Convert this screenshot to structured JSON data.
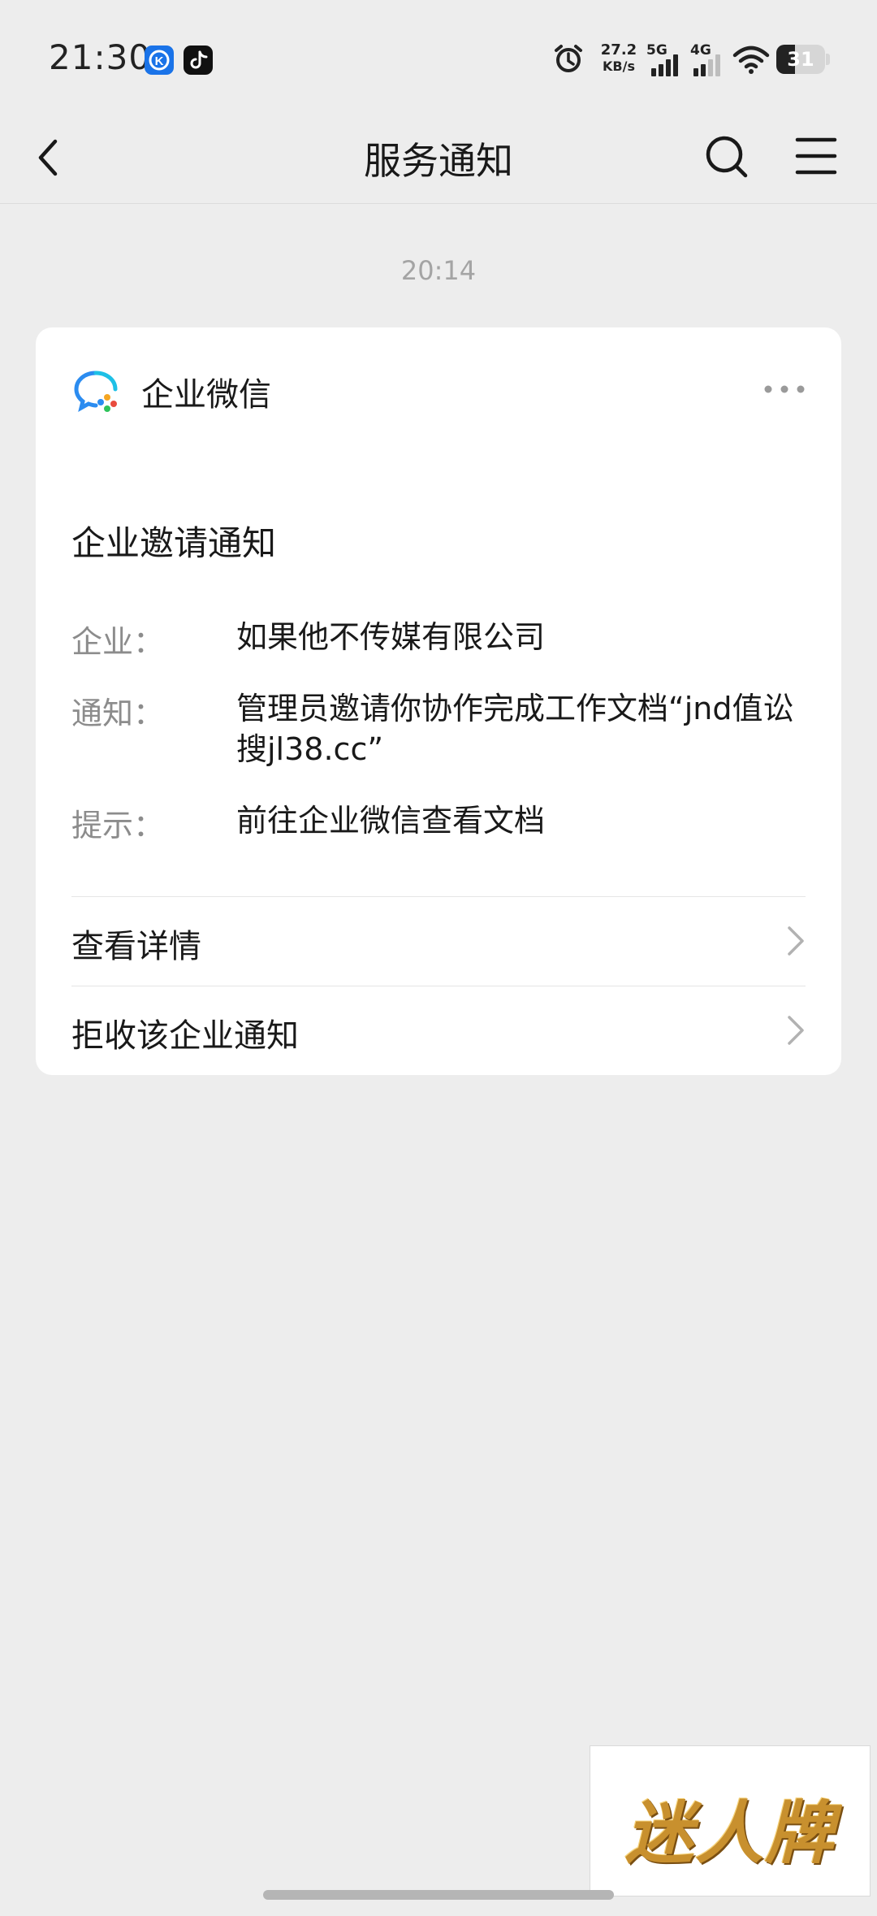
{
  "status_bar": {
    "time": "21:30",
    "net_speed_value": "27.2",
    "net_speed_unit": "KB/s",
    "sim1_label": "5G",
    "sim2_label": "4G",
    "battery_level": "31",
    "app_icons": [
      "kugou-icon",
      "tiktok-icon"
    ],
    "icons": [
      "alarm-icon",
      "signal-icon",
      "wifi-icon",
      "battery-icon"
    ]
  },
  "nav": {
    "title": "服务通知",
    "icons": [
      "back-icon",
      "search-icon",
      "menu-icon"
    ]
  },
  "timestamp": "20:14",
  "card": {
    "source_name": "企业微信",
    "notice_title": "企业邀请通知",
    "fields": {
      "company_label": "企业：",
      "company_value": "如果他不传媒有限公司",
      "notice_label": "通知：",
      "notice_value": "管理员邀请你协作完成工作文档“jnd值讼搜jl38.cc”",
      "hint_label": "提示：",
      "hint_value": "前往企业微信查看文档"
    },
    "actions": {
      "details_label": "查看详情",
      "reject_label": "拒收该企业通知"
    }
  },
  "watermark": {
    "text": "迷人牌"
  },
  "colors": {
    "background": "#ededed",
    "card": "#ffffff",
    "muted_text": "#8c8c8c",
    "timestamp": "#a4a4a4"
  }
}
